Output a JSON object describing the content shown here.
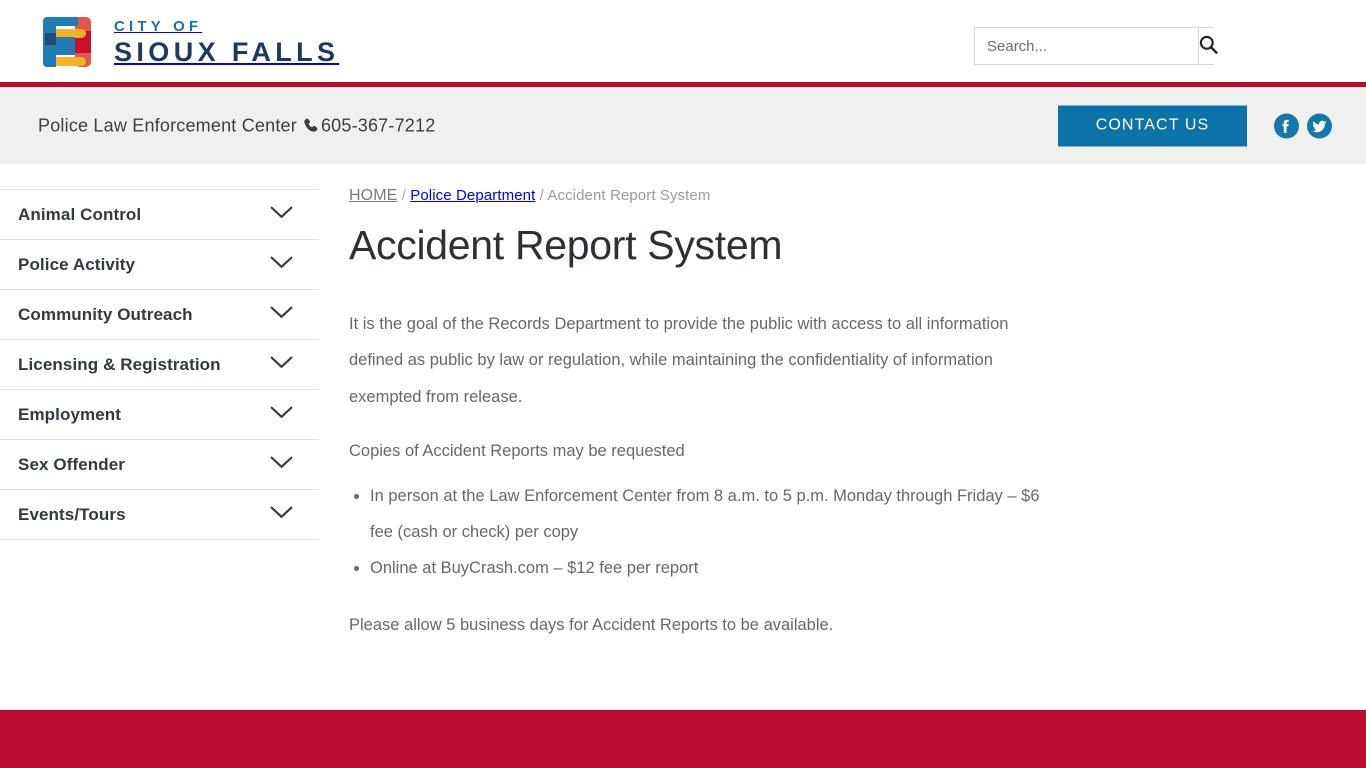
{
  "header": {
    "logo": {
      "line1": "CITY OF",
      "line2": "SIOUX FALLS",
      "mark_icon": "sioux-falls-logo-mark"
    },
    "search": {
      "placeholder": "Search...",
      "value": "",
      "button_icon": "search-icon"
    },
    "accent_color": "#ba0c2f"
  },
  "contact_bar": {
    "department": "Police Law Enforcement Center",
    "phone": "605-367-7212",
    "phone_icon": "phone-icon",
    "contact_button": "CONTACT US",
    "contact_button_color": "#0c72a7",
    "social": [
      {
        "name": "facebook-icon",
        "label": "Facebook"
      },
      {
        "name": "twitter-icon",
        "label": "Twitter"
      }
    ]
  },
  "sidebar": {
    "items": [
      {
        "label": "Animal Control",
        "icon": "chevron-down-icon"
      },
      {
        "label": "Police Activity",
        "icon": "chevron-down-icon"
      },
      {
        "label": "Community Outreach",
        "icon": "chevron-down-icon"
      },
      {
        "label": "Licensing & Registration",
        "icon": "chevron-down-icon"
      },
      {
        "label": "Employment",
        "icon": "chevron-down-icon"
      },
      {
        "label": "Sex Offender",
        "icon": "chevron-down-icon"
      },
      {
        "label": "Events/Tours",
        "icon": "chevron-down-icon"
      }
    ]
  },
  "main": {
    "breadcrumb": {
      "home": "HOME",
      "sep1": "/",
      "parent": "Police Department",
      "sep2": "/",
      "current": "Accident Report System"
    },
    "title": "Accident Report System",
    "paragraph1": "It is the goal of the Records Department to provide the public with access to all information defined as public by law or regulation, while maintaining the confidentiality of information exempted from release.",
    "paragraph2": "Copies of Accident Reports may be requested",
    "list": [
      "In person at the Law Enforcement Center from 8 a.m. to 5 p.m. Monday through Friday – $6 fee (cash or check) per copy",
      "Online at BuyCrash.com – $12 fee per report"
    ],
    "paragraph3": "Please allow 5 business days for Accident Reports to be available."
  },
  "footer": {
    "color": "#ba0c2f"
  }
}
